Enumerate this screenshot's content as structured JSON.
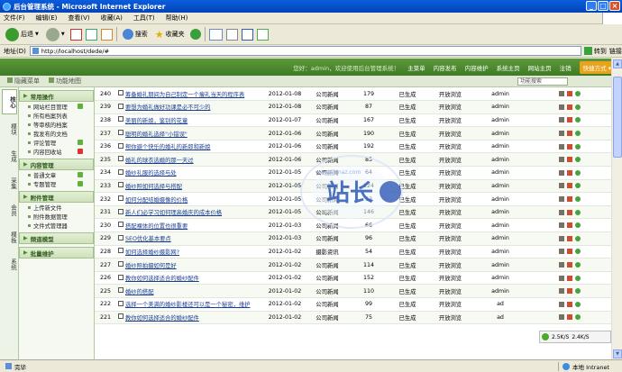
{
  "window": {
    "title": "后台管理系统 - Microsoft Internet Explorer"
  },
  "menu": [
    "文件(F)",
    "编辑(E)",
    "查看(V)",
    "收藏(A)",
    "工具(T)",
    "帮助(H)"
  ],
  "toolbar": {
    "back": "后退",
    "search": "搜索",
    "favorites": "收藏夹"
  },
  "address": {
    "label": "地址(D)",
    "url": "http://localhost/dede/#",
    "go": "转到",
    "links": "链接"
  },
  "header": {
    "greeting": "您好：admin，欢迎使用后台管理系统！",
    "nav": [
      "主菜单",
      "内容发布",
      "内容维护",
      "系统主页",
      "网站主页",
      "注销"
    ],
    "quick": "快捷方式"
  },
  "subheader": {
    "hide_menu": "隐藏菜单",
    "map": "功能地图",
    "search_placeholder": "功能搜索"
  },
  "sidetabs": [
    "核心",
    "模块",
    "生成",
    "采集",
    "会员",
    "模板",
    "系统"
  ],
  "sidebar": {
    "groups": [
      {
        "title": "常用操作",
        "items": [
          "网站栏目管理",
          "所有档案列表",
          "等审核的档案",
          "我发布的文档",
          "评论管理",
          "内容回收站"
        ]
      },
      {
        "title": "内容管理",
        "items": [
          "普通文章",
          "专题管理"
        ]
      },
      {
        "title": "附件管理",
        "items": [
          "上传新文件",
          "附件数据管理",
          "文件式管理器"
        ]
      },
      {
        "title": "频道模型",
        "items": []
      },
      {
        "title": "批量维护",
        "items": []
      }
    ]
  },
  "rows": [
    {
      "id": "240",
      "title": "筹备婚礼期间为自己制定一个瘦礼当天的程序表",
      "date": "2012-01-08",
      "cat": "公司新闻",
      "clicks": "179",
      "state": "已生成",
      "access": "开放浏览",
      "author": "admin"
    },
    {
      "id": "239",
      "title": "要想为婚礼做好功课是必不可少的",
      "date": "2012-01-08",
      "cat": "公司新闻",
      "clicks": "87",
      "state": "已生成",
      "access": "开放浏览",
      "author": "admin"
    },
    {
      "id": "238",
      "title": "美丽的新娘，鉴别的花童",
      "date": "2012-01-07",
      "cat": "公司新闻",
      "clicks": "167",
      "state": "已生成",
      "access": "开放浏览",
      "author": "admin"
    },
    {
      "id": "237",
      "title": "聪明的婚礼选择\"小错误\"",
      "date": "2012-01-06",
      "cat": "公司新闻",
      "clicks": "190",
      "state": "已生成",
      "access": "开放浏览",
      "author": "admin"
    },
    {
      "id": "236",
      "title": "帮你避个快乐的婚礼的新郎和新娘",
      "date": "2012-01-06",
      "cat": "公司新闻",
      "clicks": "192",
      "state": "已生成",
      "access": "开放浏览",
      "author": "admin"
    },
    {
      "id": "235",
      "title": "婚礼的球衣选婚的那一天过",
      "date": "2012-01-06",
      "cat": "公司新闻",
      "clicks": "85",
      "state": "已生成",
      "access": "开放浏览",
      "author": "admin"
    },
    {
      "id": "234",
      "title": "婚纱礼服的选择与处",
      "date": "2012-01-05",
      "cat": "公司新闻",
      "clicks": "64",
      "state": "已生成",
      "access": "开放浏览",
      "author": "admin"
    },
    {
      "id": "233",
      "title": "婚纱照如何选择与搭配",
      "date": "2012-01-05",
      "cat": "公司新闻",
      "clicks": "124",
      "state": "已生成",
      "access": "开放浏览",
      "author": "admin"
    },
    {
      "id": "232",
      "title": "如何分配结婚摄像的价格",
      "date": "2012-01-05",
      "cat": "公司新闻",
      "clicks": "53",
      "state": "已生成",
      "access": "开放浏览",
      "author": "admin"
    },
    {
      "id": "231",
      "title": "新人们必学习如何理高婚庆的成本价格",
      "date": "2012-01-05",
      "cat": "公司新闻",
      "clicks": "146",
      "state": "已生成",
      "access": "开放浏览",
      "author": "admin"
    },
    {
      "id": "230",
      "title": "搭配裸体的位置也很重要",
      "date": "2012-01-03",
      "cat": "公司新闻",
      "clicks": "66",
      "state": "已生成",
      "access": "开放浏览",
      "author": "admin"
    },
    {
      "id": "229",
      "title": "SEO优化基本要点",
      "date": "2012-01-03",
      "cat": "公司新闻",
      "clicks": "96",
      "state": "已生成",
      "access": "开放浏览",
      "author": "admin"
    },
    {
      "id": "228",
      "title": "如何选择婚纱摄影网?",
      "date": "2012-01-02",
      "cat": "摄影资讯",
      "clicks": "54",
      "state": "已生成",
      "access": "开放浏览",
      "author": "admin"
    },
    {
      "id": "227",
      "title": "婚纱照拍摄如何是好",
      "date": "2012-01-02",
      "cat": "公司新闻",
      "clicks": "114",
      "state": "已生成",
      "access": "开放浏览",
      "author": "admin"
    },
    {
      "id": "226",
      "title": "教你如何选择适合的婚纱配件",
      "date": "2012-01-02",
      "cat": "公司新闻",
      "clicks": "152",
      "state": "已生成",
      "access": "开放浏览",
      "author": "admin"
    },
    {
      "id": "225",
      "title": "婚纱的搭配",
      "date": "2012-01-02",
      "cat": "公司新闻",
      "clicks": "110",
      "state": "已生成",
      "access": "开放浏览",
      "author": "admin"
    },
    {
      "id": "222",
      "title": "选择一个美满的婚纱影楼还可以是一个秘密，维护",
      "date": "2012-01-02",
      "cat": "公司新闻",
      "clicks": "99",
      "state": "已生成",
      "access": "开放浏览",
      "author": "ad"
    },
    {
      "id": "221",
      "title": "教你如何选择适合的婚纱配件",
      "date": "2012-01-02",
      "cat": "公司新闻",
      "clicks": "75",
      "state": "已生成",
      "access": "开放浏览",
      "author": "ad"
    }
  ],
  "speed": {
    "up": "2.5K/S",
    "down": "2.4K/S"
  },
  "status": {
    "left": "完毕",
    "zone": "本地 Intranet"
  },
  "watermark": {
    "brand": "站长",
    "domain": "www.chinaz.com"
  }
}
